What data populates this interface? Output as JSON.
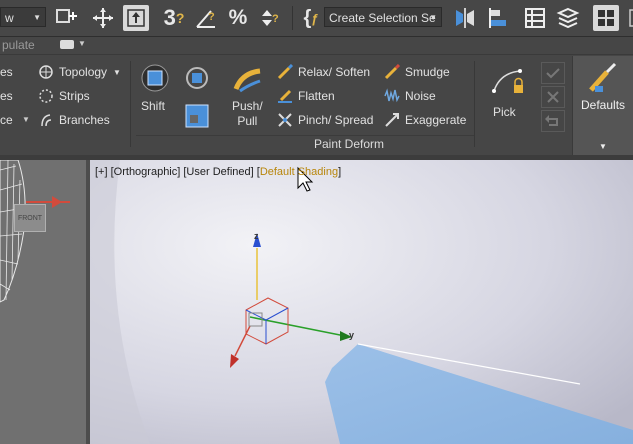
{
  "toolbar": {
    "left_dropdown": "w",
    "selection_set_placeholder": "Create Selection Se",
    "icons": [
      "snap-toggle-icon",
      "move-icon",
      "select-object-icon",
      "snap-3d-icon",
      "angle-snap-icon",
      "percent-snap-icon",
      "spinner-snap-icon",
      "edit-named-selection-icon",
      "mirror-icon",
      "align-icon",
      "scene-explorer-icon",
      "layer-manager-icon",
      "ribbon-toggle-icon"
    ]
  },
  "row2": {
    "label": "pulate"
  },
  "ribbon": {
    "polymodeling": {
      "left_items": [
        "es",
        "es",
        "ce"
      ],
      "topology": "Topology",
      "strips": "Strips",
      "branches": "Branches"
    },
    "shift": "Shift",
    "push_pull": "Push/\nPull",
    "paint_deform": {
      "relax_soften": "Relax/ Soften",
      "flatten": "Flatten",
      "pinch_spread": "Pinch/ Spread",
      "smudge": "Smudge",
      "noise": "Noise",
      "exaggerate": "Exaggerate",
      "panel_label": "Paint Deform"
    },
    "pick": "Pick",
    "defaults": "Defaults"
  },
  "viewport": {
    "label_plus": "[+]",
    "label_view": "[Orthographic]",
    "label_user": "[User Defined]",
    "label_shading_open": "[",
    "label_shading": "Default Shading",
    "label_shading_close": "]",
    "axis_x": "x",
    "axis_y": "y",
    "axis_z": "z",
    "left_view_badge": "FRONT"
  }
}
